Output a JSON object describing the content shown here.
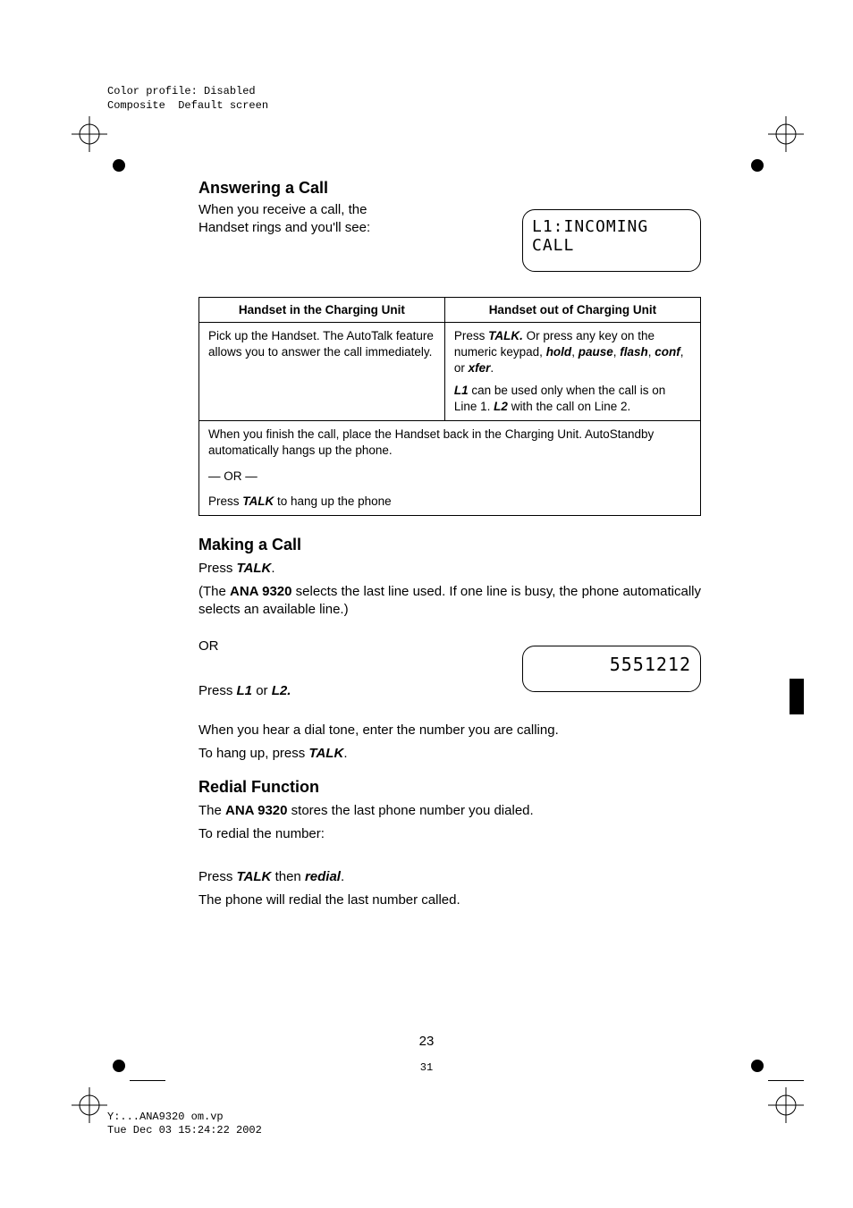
{
  "meta": {
    "color_profile": "Color profile: Disabled",
    "composite": "Composite  Default screen",
    "footer_path": "Y:...ANA9320 om.vp",
    "footer_date": "Tue Dec 03 15:24:22 2002"
  },
  "answering": {
    "heading": "Answering a Call",
    "intro1": "When you receive a call, the",
    "intro2": "Handset rings and you'll see:",
    "lcd": "L1:INCOMING CALL"
  },
  "table": {
    "h1": "Handset in the Charging Unit",
    "h2": "Handset out of Charging Unit",
    "c1": "Pick up the Handset.  The AutoTalk feature allows you to answer the call immediately.",
    "c2a_pre": "Press ",
    "c2a_talk": "TALK.",
    "c2a_mid1": " Or press any key on the numeric keypad, ",
    "c2a_hold": "hold",
    "c2a_sep1": ", ",
    "c2a_pause": "pause",
    "c2a_sep2": ", ",
    "c2a_flash": "flash",
    "c2a_sep3": ", ",
    "c2a_conf": "conf",
    "c2a_or": ", or ",
    "c2a_xfer": "xfer",
    "c2a_end": ".",
    "c2b_l1": "L1",
    "c2b_mid": " can be used only when the call is on Line 1. ",
    "c2b_l2": "L2",
    "c2b_end": " with the call on Line 2.",
    "full": {
      "line1": "When you finish the call, place the Handset back in the Charging Unit. AutoStandby automatically hangs up the phone.",
      "or": "— OR —",
      "line2_pre": "Press ",
      "line2_talk": "TALK",
      "line2_post": " to hang up the phone"
    }
  },
  "making": {
    "heading": "Making a Call",
    "press_pre": "Press ",
    "press_talk": "TALK",
    "press_post": ".",
    "ana_pre": "(The ",
    "ana_bold": "ANA 9320",
    "ana_post": " selects the last line used. If one line is busy, the phone automatically selects an available line.)",
    "or": "OR",
    "press2_pre": "Press ",
    "press2_l1": "L1",
    "press2_mid": " or ",
    "press2_l2": "L2.",
    "lcd": "5551212",
    "dial": "When you hear a dial tone, enter the number you are calling.",
    "hang_pre": "To hang up, press ",
    "hang_talk": "TALK",
    "hang_post": "."
  },
  "redial": {
    "heading": "Redial Function",
    "line1_pre": "The ",
    "line1_bold": "ANA 9320",
    "line1_post": " stores the last phone number you dialed.",
    "line2": "To redial the number:",
    "press_pre": "Press ",
    "press_talk": "TALK",
    "press_mid": " then ",
    "press_redial": "redial",
    "press_post": ".",
    "last": "The phone will redial the last number called."
  },
  "pagenum": "23",
  "pagenum_small": "31"
}
